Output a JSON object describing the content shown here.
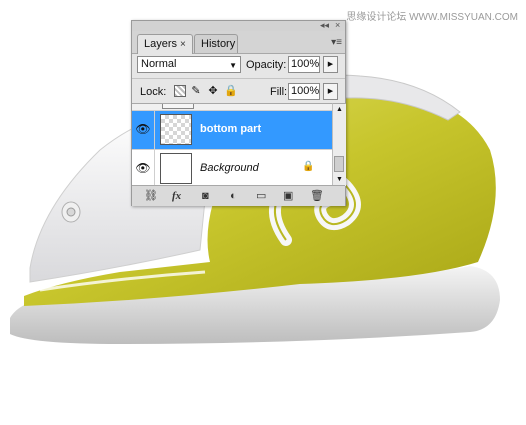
{
  "watermark": "思缘设计论坛 WWW.MISSYUAN.COM",
  "panel": {
    "tabs": [
      {
        "label": "Layers",
        "active": true,
        "close": "×"
      },
      {
        "label": "History",
        "active": false
      }
    ],
    "titlebar_buttons": {
      "minimize": "◂◂",
      "close": "×"
    },
    "menu_icon": "▾≡",
    "blend_mode": "Normal",
    "opacity_label": "Opacity:",
    "opacity_value": "100%",
    "lock_label": "Lock:",
    "lock_icons": [
      "lock-transparent-icon",
      "lock-brush-icon",
      "lock-move-icon",
      "lock-all-icon"
    ],
    "fill_label": "Fill:",
    "fill_value": "100%",
    "layers": [
      {
        "name": "bottom part",
        "selected": true,
        "visible": true,
        "thumb": "transparent"
      },
      {
        "name": "Background",
        "selected": false,
        "visible": true,
        "thumb": "white",
        "locked": true
      }
    ],
    "bottom_buttons": [
      "link-layers-icon",
      "fx-icon",
      "add-mask-icon",
      "adjustment-layer-icon",
      "new-group-icon",
      "new-layer-icon",
      "trash-icon"
    ],
    "bottom_labels": {
      "link": "⛓",
      "fx": "fx",
      "mask": "◙",
      "adjust": "◐",
      "group": "▭",
      "new": "▣",
      "trash": "🗑"
    }
  },
  "colors": {
    "accent": "#3399ff",
    "iron_yellow": "#c8c630",
    "iron_white": "#f2f2f4"
  }
}
